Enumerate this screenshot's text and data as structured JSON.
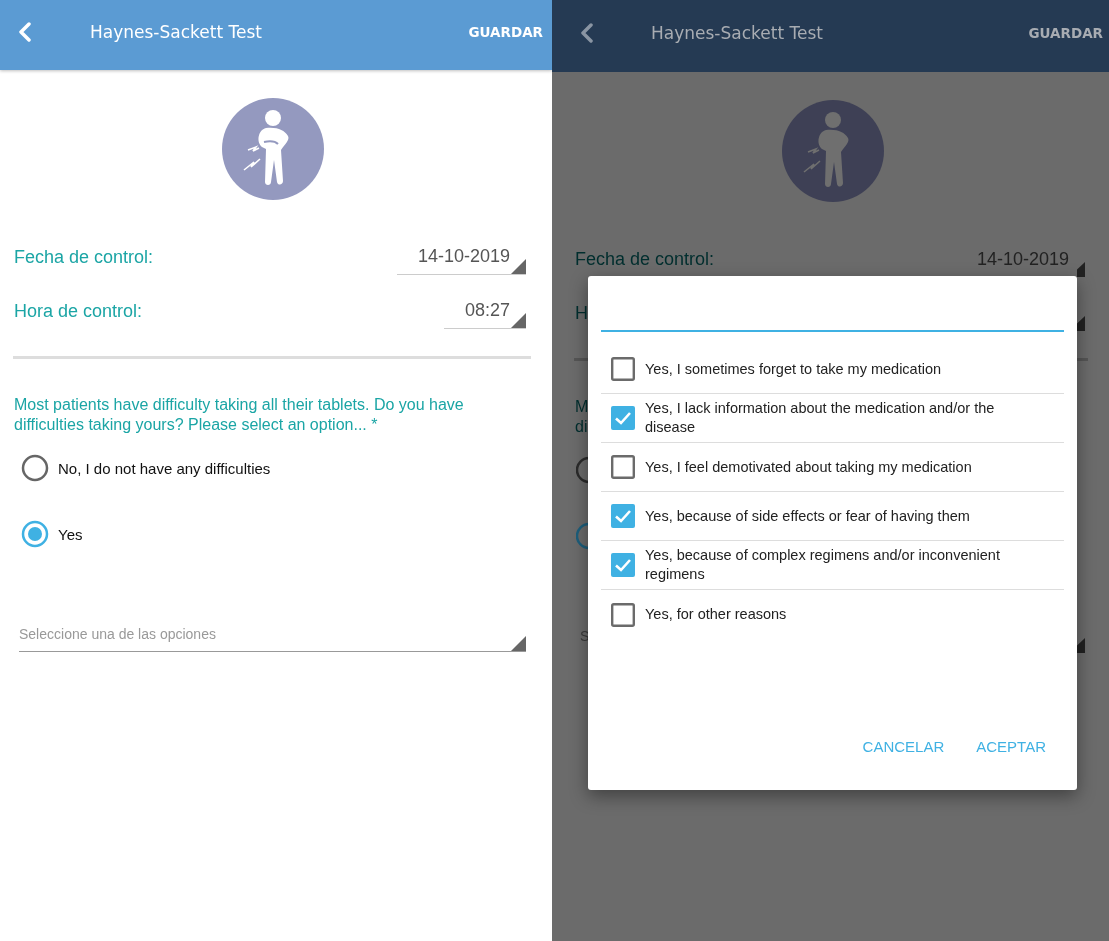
{
  "left_screen": {
    "header": {
      "title": "Haynes-Sackett Test",
      "action": "GUARDAR"
    },
    "fields": [
      {
        "label": "Fecha de control:",
        "value": "14-10-2019"
      },
      {
        "label": "Hora de control:",
        "value": "08:27"
      }
    ],
    "question": "Most patients have difficulty taking all their tablets. Do you have difficulties taking yours? Please select an option... *",
    "options": [
      {
        "label": "No, I do not have any difficulties",
        "selected": false
      },
      {
        "label": "Yes",
        "selected": true
      }
    ],
    "select": {
      "placeholder": "Seleccione una de las opciones"
    }
  },
  "right_screen": {
    "header": {
      "title": "Haynes-Sackett Test",
      "action": "GUARDAR"
    },
    "fields": [
      {
        "label": "Fecha de control:",
        "value": "14-10-2019"
      },
      {
        "label": "H"
      }
    ],
    "question_lines": [
      "M",
      "di"
    ],
    "radio_edges": [
      {
        "selected": false
      },
      {
        "selected": true
      }
    ],
    "select_fragment": "S",
    "dialog": {
      "options": [
        {
          "label": "Yes, I sometimes forget to take my medication",
          "checked": false
        },
        {
          "label": "Yes, I lack information about the medication and/or the disease",
          "checked": true
        },
        {
          "label": "Yes, I feel demotivated about taking my medication",
          "checked": false
        },
        {
          "label": "Yes, because of side effects or fear of having them",
          "checked": true
        },
        {
          "label": "Yes, because of complex regimens and/or inconvenient regimens",
          "checked": true
        },
        {
          "label": "Yes, for other reasons",
          "checked": false
        }
      ],
      "buttons": [
        "CANCELAR",
        "ACEPTAR"
      ]
    }
  }
}
